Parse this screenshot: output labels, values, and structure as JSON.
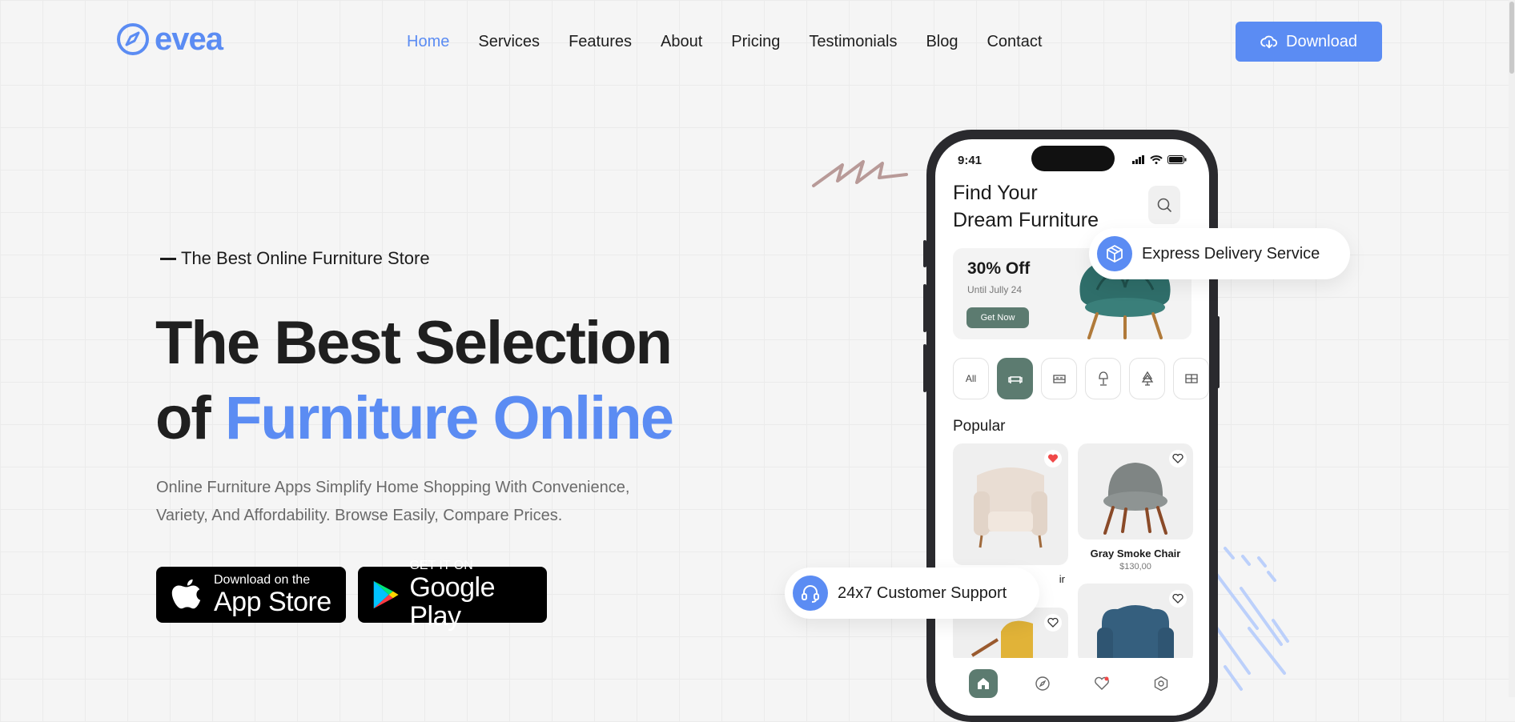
{
  "brand": {
    "name": "evea",
    "color": "#5b8cf3"
  },
  "nav": {
    "items": [
      {
        "label": "Home",
        "active": true
      },
      {
        "label": "Services"
      },
      {
        "label": "Features"
      },
      {
        "label": "About"
      },
      {
        "label": "Pricing"
      },
      {
        "label": "Testimonials"
      },
      {
        "label": "Blog"
      },
      {
        "label": "Contact"
      }
    ]
  },
  "header": {
    "download_label": "Download",
    "download_icon": "cloud-download-icon"
  },
  "hero": {
    "eyebrow": "The Best Online Furniture Store",
    "headline_line1": "The Best Selection",
    "headline_of": "of",
    "headline_accent": "Furniture Online",
    "description": "Online Furniture Apps Simplify Home Shopping With Convenience, Variety, And Affordability. Browse Easily, Compare Prices."
  },
  "stores": {
    "appstore": {
      "small": "Download on the",
      "big": "App Store",
      "icon": "apple-icon"
    },
    "googleplay": {
      "small": "GET IT ON",
      "big": "Google Play",
      "icon": "google-play-icon"
    }
  },
  "phone": {
    "time": "9:41",
    "title_line1": "Find Your",
    "title_line2": "Dream Furniture",
    "promo": {
      "title": "30% Off",
      "subtitle": "Until Jully 24",
      "button": "Get Now"
    },
    "categories": [
      {
        "label": "All"
      },
      {
        "icon": "sofa-icon",
        "active": true
      },
      {
        "icon": "bed-icon"
      },
      {
        "icon": "lamp-icon"
      },
      {
        "icon": "plant-icon"
      },
      {
        "icon": "cabinet-icon"
      }
    ],
    "section_title": "Popular",
    "products": [
      {
        "name": "Gray Smoke Chair",
        "price": "$130,00",
        "favorited": false
      },
      {
        "name": "ir",
        "favorited": true
      }
    ],
    "bottom_nav": [
      "home-icon",
      "compass-icon",
      "heart-icon",
      "settings-icon"
    ]
  },
  "badges": {
    "delivery": "Express Delivery Service",
    "support": "24x7 Customer Support"
  },
  "colors": {
    "accent": "#5b8cf3",
    "app_green": "#5c7b70",
    "heart_red": "#f04848"
  }
}
